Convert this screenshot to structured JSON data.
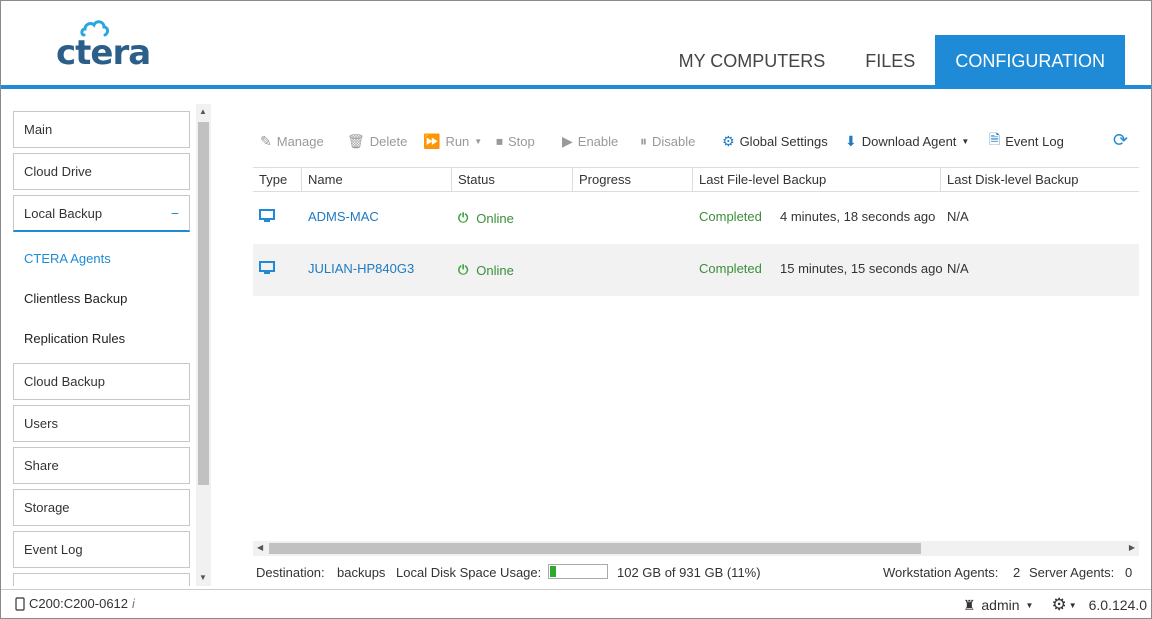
{
  "header": {
    "logo_text": "ctera",
    "tabs": [
      {
        "label": "MY COMPUTERS",
        "active": false
      },
      {
        "label": "FILES",
        "active": false
      },
      {
        "label": "CONFIGURATION",
        "active": true
      }
    ]
  },
  "sidebar": {
    "items": [
      {
        "label": "Main"
      },
      {
        "label": "Cloud Drive"
      },
      {
        "label": "Local Backup",
        "collapse": "−"
      },
      {
        "label": "Cloud Backup"
      },
      {
        "label": "Users"
      },
      {
        "label": "Share"
      },
      {
        "label": "Storage"
      },
      {
        "label": "Event Log"
      }
    ],
    "sub_items": [
      {
        "label": "CTERA Agents",
        "active": true
      },
      {
        "label": "Clientless Backup"
      },
      {
        "label": "Replication Rules"
      }
    ]
  },
  "toolbar": {
    "manage": "Manage",
    "delete": "Delete",
    "run": "Run",
    "stop": "Stop",
    "enable": "Enable",
    "disable": "Disable",
    "global_settings": "Global Settings",
    "download_agent": "Download Agent",
    "event_log": "Event Log"
  },
  "table": {
    "columns": [
      "Type",
      "Name",
      "Status",
      "Progress",
      "Last File-level Backup",
      "Last Disk-level Backup"
    ],
    "rows": [
      {
        "name": "ADMS-MAC",
        "status": "Online",
        "progress": "",
        "file_backup_status": "Completed",
        "file_backup_time": "4 minutes, 18 seconds ago",
        "disk_backup": "N/A"
      },
      {
        "name": "JULIAN-HP840G3",
        "status": "Online",
        "progress": "",
        "file_backup_status": "Completed",
        "file_backup_time": "15 minutes, 15 seconds ago",
        "disk_backup": "N/A"
      }
    ]
  },
  "status": {
    "destination_label": "Destination:",
    "destination_value": "backups",
    "usage_label": "Local Disk Space Usage:",
    "usage_text": "102 GB of 931 GB (11%)",
    "usage_fraction": 0.11,
    "workstation_label": "Workstation Agents:",
    "workstation_count": "2",
    "server_label": "Server Agents:",
    "server_count": "0"
  },
  "footer": {
    "device": "C200:C200-0612",
    "user": "admin",
    "version": "6.0.124.0"
  },
  "colors": {
    "accent": "#1f8ad6",
    "online": "#3a8f3a"
  }
}
